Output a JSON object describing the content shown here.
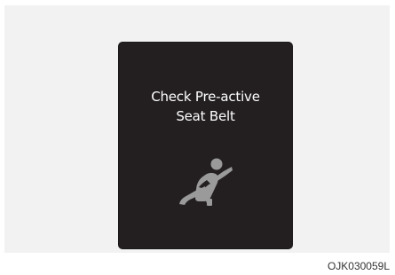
{
  "display": {
    "message_line_1": "Check Pre-active",
    "message_line_2": "Seat Belt",
    "icon": "seatbelt-warning-icon",
    "background_color": "#231f20",
    "text_color": "#ffffff",
    "icon_color": "#9a9a9a"
  },
  "figure": {
    "code": "OJK030059L"
  }
}
